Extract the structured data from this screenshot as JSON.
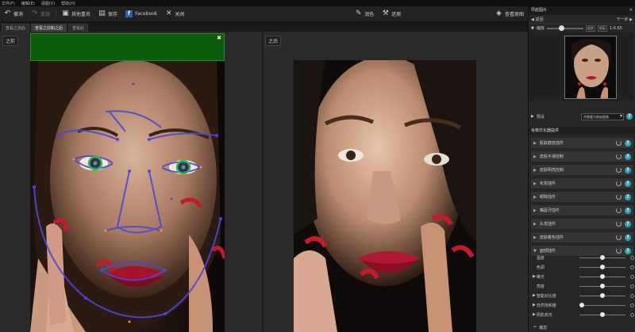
{
  "menubar": [
    "文件(F)",
    "编辑(E)",
    "视图(V)",
    "帮助(H)"
  ],
  "toolbar": {
    "undo": "撤消",
    "redo": "重做",
    "other_save": "其他重名",
    "save": "保存",
    "facebook": "Facebook",
    "close": "关闭",
    "color": "润色",
    "restore": "还原",
    "view_original": "查看原图"
  },
  "tabs": [
    "查看之前后",
    "查看之前和之后",
    "查看后"
  ],
  "canvas": {
    "before_label": "之前",
    "after_label": "之后"
  },
  "right_panel": {
    "header": "导航图片",
    "back": "返回",
    "next": "下一步",
    "zoom_label": "缩放",
    "fit": "适合",
    "actual": "实际",
    "zoom_value": "1:6.65",
    "zoom_level": 0.4,
    "preset_label": "预设",
    "preset_value": "肖像重为原始图像",
    "panel_title": "肖像优化器提供",
    "tools": [
      "肌肤磨皮插件",
      "皮肤平滑控制",
      "皮肤明亮控制",
      "化妆插件",
      "眼睛插件",
      "嘴唇牙插件",
      "头发插件",
      "皮肤着色插件",
      "面部插件"
    ],
    "sliders": [
      {
        "label": "温度",
        "value": 0.5,
        "indent": false
      },
      {
        "label": "色调",
        "value": 0.5,
        "indent": false
      },
      {
        "label": "曝光",
        "value": 0.5,
        "indent": true
      },
      {
        "label": "亮度",
        "value": 0.5,
        "indent": false
      },
      {
        "label": "智能对比度",
        "value": 0.5,
        "indent": true
      },
      {
        "label": "自然饱和度",
        "value": 0.05,
        "indent": true
      },
      {
        "label": "阴影高光",
        "value": 0.5,
        "indent": true
      }
    ],
    "footer": "裁剪"
  },
  "colors": {
    "accent": "#2e9fb8",
    "green_bar": "#0b5d0b",
    "face_mesh": "#4b48d6",
    "eye_marker": "#2fbf4a",
    "lip": "#b01730"
  }
}
